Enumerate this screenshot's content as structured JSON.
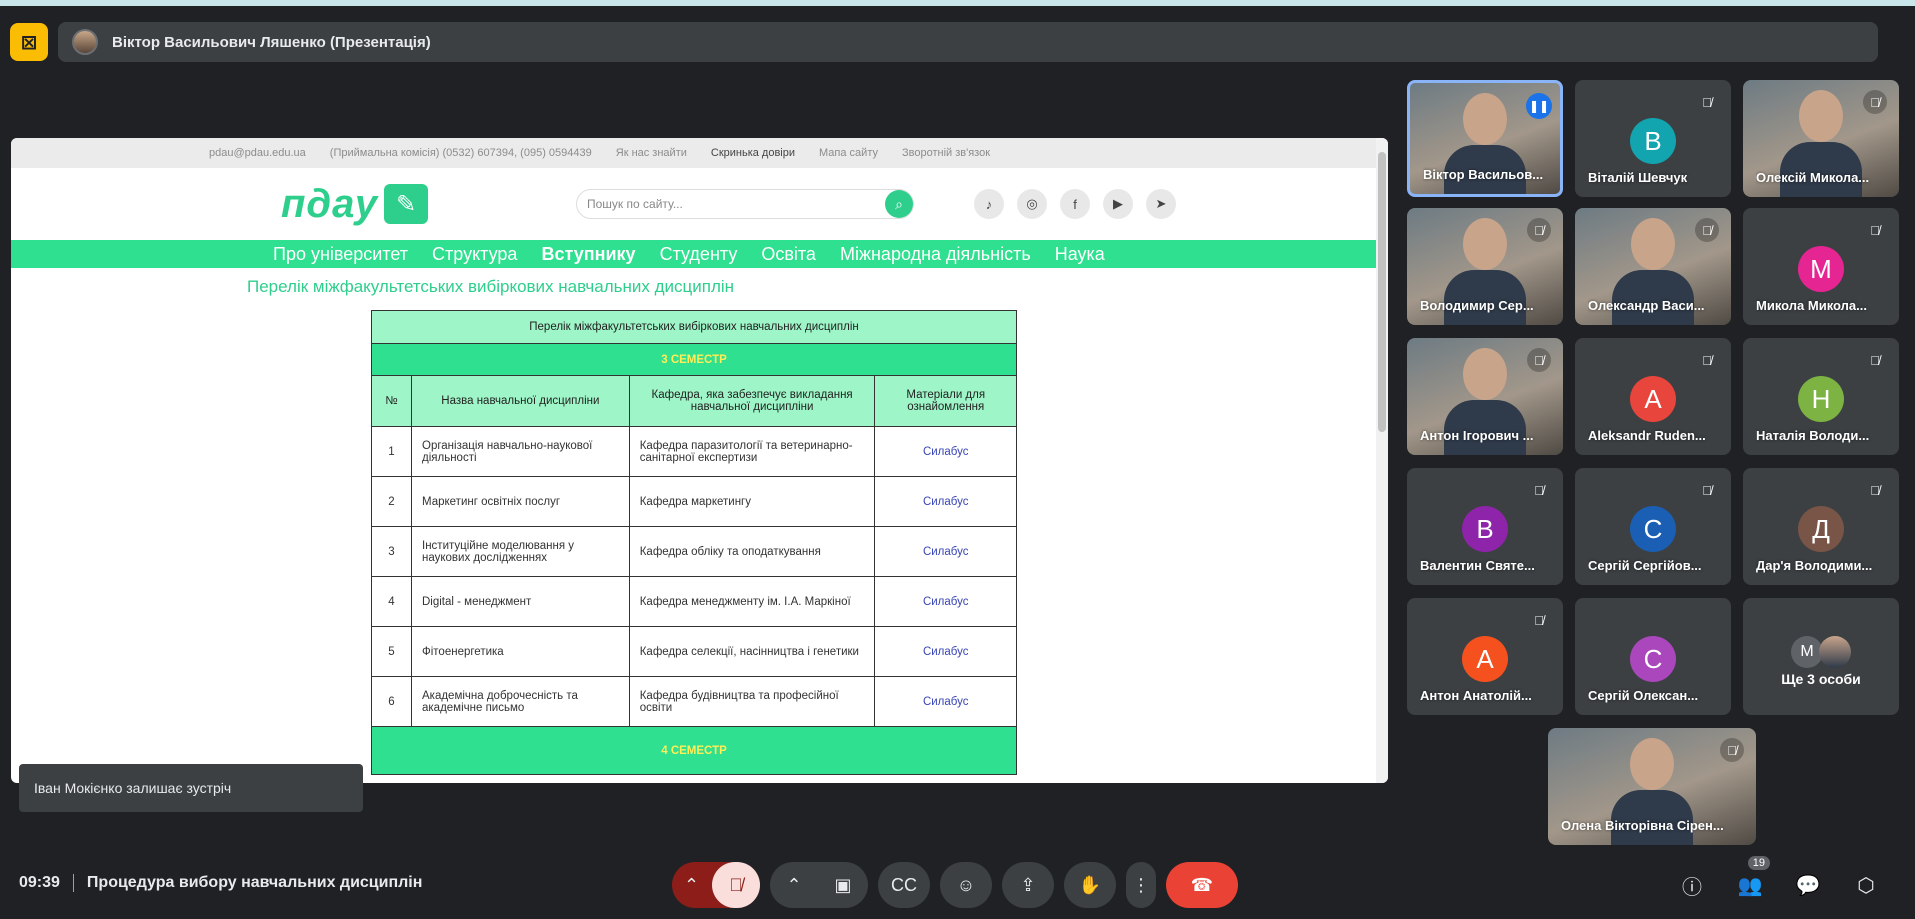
{
  "top_bar": {
    "presenter_label": "Віктор Васильович Ляшенко (Презентація)"
  },
  "site": {
    "top_links": [
      "pdau@pdau.edu.ua",
      "(Приймальна комісія)  (0532) 607394,  (095) 0594439",
      "Як нас знайти",
      "Скринька довіри",
      "Мапа сайту",
      "Зворотній зв'язок"
    ],
    "logo_text": "пдау",
    "search_placeholder": "Пошук по сайту...",
    "nav": [
      "Про університет",
      "Структура",
      "Вступнику",
      "Студенту",
      "Освіта",
      "Міжнародна діяльність",
      "Наука"
    ],
    "page_title": "Перелік міжфакультетських вибіркових навчальних дисциплін"
  },
  "table": {
    "caption": "Перелік міжфакультетських вибіркових навчальних дисциплін",
    "semester3": "3 СЕМЕСТР",
    "semester4": "4 СЕМЕСТР",
    "headers": [
      "№",
      "Назва навчальної дисципліни",
      "Кафедра, яка забезпечує викладання навчальної дисципліни",
      "Матеріали для ознайомлення"
    ],
    "rows": [
      {
        "num": "1",
        "name": "Організація навчально-наукової діяльності",
        "dept": "Кафедра паразитології та ветеринарно-санітарної експертизи",
        "mat": "Силабус"
      },
      {
        "num": "2",
        "name": "Маркетинг освітніх послуг",
        "dept": "Кафедра маркетингу",
        "mat": "Силабус"
      },
      {
        "num": "3",
        "name": "Інституційне моделювання у наукових дослідженнях",
        "dept": "Кафедра обліку та оподаткування",
        "mat": "Силабус"
      },
      {
        "num": "4",
        "name": "Digital - менеджмент",
        "dept": "Кафедра менеджменту ім. І.А. Маркіної",
        "mat": "Силабус"
      },
      {
        "num": "5",
        "name": "Фітоенергетика",
        "dept": "Кафедра селекції, насінництва і генетики",
        "mat": "Силабус"
      },
      {
        "num": "6",
        "name": "Академічна доброчесність та академічне письмо",
        "dept": "Кафедра будівництва та професійної освіти",
        "mat": "Силабус"
      }
    ]
  },
  "toast": "Іван Мокієнко залишає зустріч",
  "participants": [
    {
      "name": "Віктор Васильов...",
      "initial": "",
      "color": ""
    },
    {
      "name": "Віталій Шевчук",
      "initial": "В",
      "color": "#12a4af"
    },
    {
      "name": "Олексій Микола...",
      "initial": "",
      "color": ""
    },
    {
      "name": "Володимир Сер...",
      "initial": "",
      "color": ""
    },
    {
      "name": "Олександр Васи...",
      "initial": "",
      "color": ""
    },
    {
      "name": "Микола Микола...",
      "initial": "М",
      "color": "#e52592"
    },
    {
      "name": "Антон Ігорович ...",
      "initial": "",
      "color": ""
    },
    {
      "name": "Aleksandr Ruden...",
      "initial": "А",
      "color": "#e8453c"
    },
    {
      "name": "Наталія Володи...",
      "initial": "Н",
      "color": "#7cb342"
    },
    {
      "name": "Валентин Святе...",
      "initial": "В",
      "color": "#8e24aa"
    },
    {
      "name": "Сергій Сергійов...",
      "initial": "С",
      "color": "#1a5fb4"
    },
    {
      "name": "Дар'я Володими...",
      "initial": "Д",
      "color": "#795548"
    },
    {
      "name": "Антон Анатолій...",
      "initial": "А",
      "color": "#f4511e"
    },
    {
      "name": "Сергій Олексан...",
      "initial": "С",
      "color": "#ab47bc"
    },
    {
      "name": "Олена Вікторівна Сірен..."
    }
  ],
  "more_tile": {
    "initial": "М",
    "label": "Ще 3 особи"
  },
  "bottom": {
    "clock": "09:39",
    "meeting_title": "Процедура вибору навчальних дисциплін",
    "participants_count": "19"
  }
}
